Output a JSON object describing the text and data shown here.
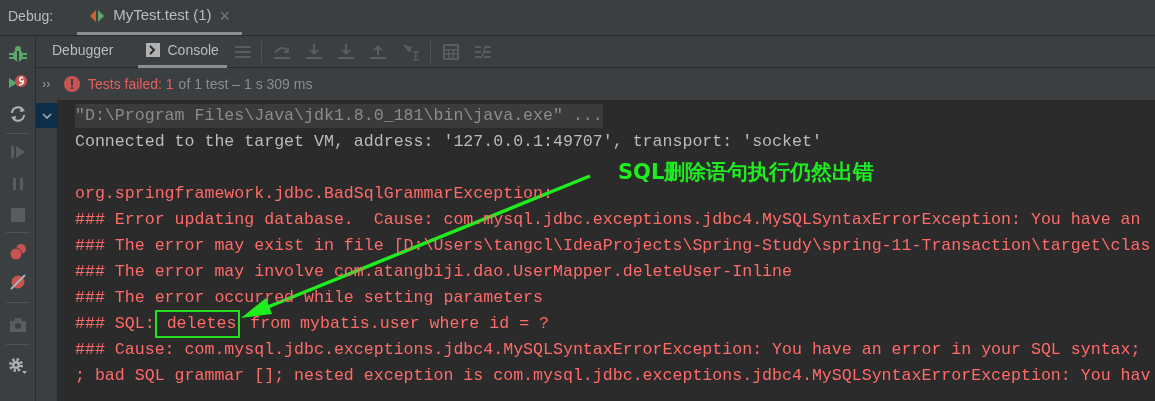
{
  "panel": {
    "label": "Debug:"
  },
  "run_tab": {
    "title": "MyTest.test (1)",
    "close": "×",
    "selected": true
  },
  "tool_tabs": [
    {
      "label": "Debugger",
      "selected": false
    },
    {
      "label": "Console",
      "selected": true
    }
  ],
  "status": {
    "expand": "››",
    "failed": "Tests failed: 1",
    "summary": "of 1 test – 1 s 309 ms"
  },
  "console": {
    "lines": [
      {
        "kind": "folded",
        "text": "\"D:\\Program Files\\Java\\jdk1.8.0_181\\bin\\java.exe\" ..."
      },
      {
        "kind": "normal",
        "text": "Connected to the target VM, address: '127.0.0.1:49707', transport: 'socket'"
      },
      {
        "kind": "blank"
      },
      {
        "kind": "error",
        "text": "org.springframework.jdbc.BadSqlGrammarException: "
      },
      {
        "kind": "error",
        "text": "### Error updating database.  Cause: com.mysql.jdbc.exceptions.jdbc4.MySQLSyntaxErrorException: You have an"
      },
      {
        "kind": "error",
        "text": "### The error may exist in file [D:\\Users\\tangcl\\IdeaProjects\\Spring-Study\\spring-11-Transaction\\target\\clas"
      },
      {
        "kind": "error",
        "text": "### The error may involve com.atangbiji.dao.UserMapper.deleteUser-Inline"
      },
      {
        "kind": "error",
        "text": "### The error occurred while setting parameters"
      },
      {
        "kind": "error",
        "parts": [
          {
            "text": "### SQL:",
            "boxed": false
          },
          {
            "text": " deletes",
            "boxed": true
          },
          {
            "text": " from mybatis.user where id = ?",
            "boxed": false
          }
        ]
      },
      {
        "kind": "error",
        "text": "### Cause: com.mysql.jdbc.exceptions.jdbc4.MySQLSyntaxErrorException: You have an error in your SQL syntax;"
      },
      {
        "kind": "error",
        "text": "; bad SQL grammar []; nested exception is com.mysql.jdbc.exceptions.jdbc4.MySQLSyntaxErrorException: You hav"
      }
    ]
  },
  "annotation": {
    "text": "SQL删除语句执行仍然出错"
  }
}
